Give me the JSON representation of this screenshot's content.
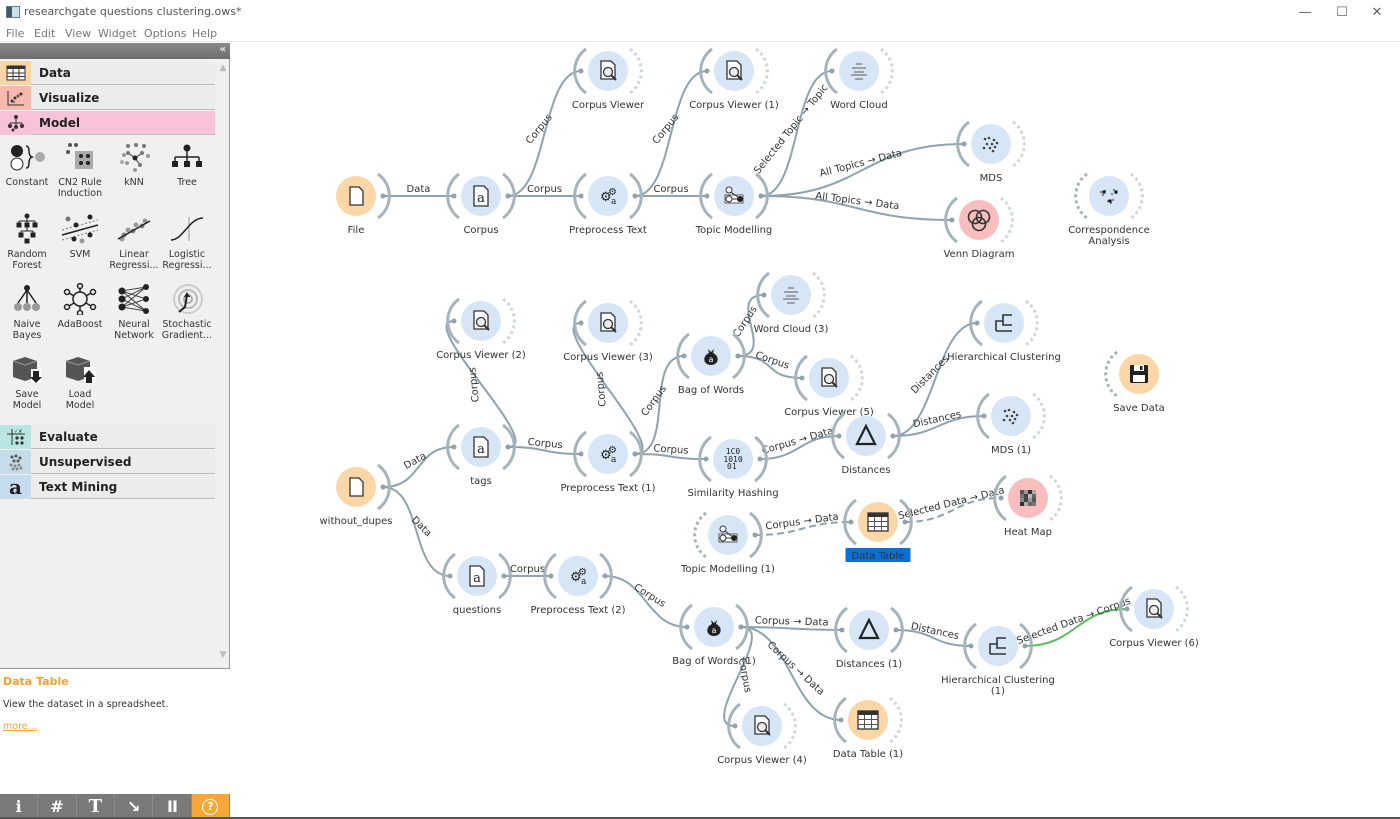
{
  "window": {
    "title": "researchgate questions clustering.ows*",
    "controls": {
      "minimize": "—",
      "maximize": "☐",
      "close": "✕"
    }
  },
  "menu": [
    "File",
    "Edit",
    "View",
    "Widget",
    "Options",
    "Help"
  ],
  "dock": {
    "collapse_icon": "«",
    "categories": [
      {
        "label": "Data",
        "icon": "data-table-icon",
        "color": "#f9d6a3"
      },
      {
        "label": "Visualize",
        "icon": "scatter-icon",
        "color": "#f7b9ad"
      },
      {
        "label": "Model",
        "icon": "hierarchy-icon",
        "color": "#f8c2d9",
        "expanded": true
      },
      {
        "label": "Evaluate",
        "icon": "evaluate-icon",
        "color": "#b9e5e2"
      },
      {
        "label": "Unsupervised",
        "icon": "clusters-icon",
        "color": "#c6dce8"
      },
      {
        "label": "Text Mining",
        "icon": "letter-a-icon",
        "color": "#c8dcef"
      }
    ],
    "model_tools": [
      {
        "label": "Constant",
        "icon": "constant-icon"
      },
      {
        "label": "CN2 Rule Induction",
        "icon": "cn2-icon"
      },
      {
        "label": "kNN",
        "icon": "knn-icon"
      },
      {
        "label": "Tree",
        "icon": "tree-icon"
      },
      {
        "label": "Random Forest",
        "icon": "random-forest-icon"
      },
      {
        "label": "SVM",
        "icon": "svm-icon"
      },
      {
        "label": "Linear Regressi...",
        "icon": "linear-regression-icon"
      },
      {
        "label": "Logistic Regressi...",
        "icon": "logistic-regression-icon"
      },
      {
        "label": "Naive Bayes",
        "icon": "naive-bayes-icon"
      },
      {
        "label": "AdaBoost",
        "icon": "adaboost-icon"
      },
      {
        "label": "Neural Network",
        "icon": "neural-network-icon"
      },
      {
        "label": "Stochastic Gradient...",
        "icon": "sgd-icon"
      },
      {
        "label": "Save Model",
        "icon": "save-model-icon"
      },
      {
        "label": "Load Model",
        "icon": "load-model-icon"
      }
    ],
    "help": {
      "title": "Data Table",
      "description": "View the dataset in a spreadsheet.",
      "more_link": "more..."
    },
    "toolbar": [
      {
        "label": "i",
        "icon": "info-icon"
      },
      {
        "label": "#",
        "icon": "grid-icon"
      },
      {
        "label": "T",
        "icon": "text-annotation-icon"
      },
      {
        "label": "↘",
        "icon": "arrow-annotation-icon"
      },
      {
        "label": "II",
        "icon": "pause-icon"
      },
      {
        "label": "?",
        "icon": "help-icon"
      }
    ]
  },
  "colors": {
    "blue_node": "#d6e6f7",
    "orange_node": "#fbd7a8",
    "red_node": "#f8bdbd",
    "link": "#8fa3ad",
    "link_selected": "#5cbb5c",
    "selection": "#0a6fd6"
  },
  "workflow": {
    "nodes": [
      {
        "id": "file",
        "label": "File",
        "kind": "orange",
        "icon": "file-icon"
      },
      {
        "id": "corpus",
        "label": "Corpus",
        "kind": "blue",
        "icon": "corpus-icon"
      },
      {
        "id": "cv0",
        "label": "Corpus Viewer",
        "kind": "blue",
        "icon": "corpus-viewer-icon"
      },
      {
        "id": "pp0",
        "label": "Preprocess Text",
        "kind": "blue",
        "icon": "preprocess-icon"
      },
      {
        "id": "cv1",
        "label": "Corpus Viewer (1)",
        "kind": "blue",
        "icon": "corpus-viewer-icon"
      },
      {
        "id": "tm0",
        "label": "Topic Modelling",
        "kind": "blue",
        "icon": "topic-modelling-icon"
      },
      {
        "id": "wc0",
        "label": "Word Cloud",
        "kind": "blue",
        "icon": "word-cloud-icon"
      },
      {
        "id": "mds0",
        "label": "MDS",
        "kind": "blue",
        "icon": "mds-icon"
      },
      {
        "id": "venn",
        "label": "Venn Diagram",
        "kind": "red",
        "icon": "venn-icon"
      },
      {
        "id": "ca",
        "label": "Correspondence Analysis",
        "kind": "blue",
        "icon": "correspondence-icon"
      },
      {
        "id": "wd",
        "label": "without_dupes",
        "kind": "orange",
        "icon": "file-icon"
      },
      {
        "id": "tags",
        "label": "tags",
        "kind": "blue",
        "icon": "corpus-icon"
      },
      {
        "id": "cv2",
        "label": "Corpus Viewer (2)",
        "kind": "blue",
        "icon": "corpus-viewer-icon"
      },
      {
        "id": "pp1",
        "label": "Preprocess Text (1)",
        "kind": "blue",
        "icon": "preprocess-icon"
      },
      {
        "id": "cv3",
        "label": "Corpus Viewer (3)",
        "kind": "blue",
        "icon": "corpus-viewer-icon"
      },
      {
        "id": "bow0",
        "label": "Bag of Words",
        "kind": "blue",
        "icon": "bag-of-words-icon"
      },
      {
        "id": "wc3",
        "label": "Word Cloud (3)",
        "kind": "blue",
        "icon": "word-cloud-icon"
      },
      {
        "id": "cv5",
        "label": "Corpus Viewer (5)",
        "kind": "blue",
        "icon": "corpus-viewer-icon"
      },
      {
        "id": "sh",
        "label": "Similarity Hashing",
        "kind": "blue",
        "icon": "similarity-hashing-icon"
      },
      {
        "id": "dist0",
        "label": "Distances",
        "kind": "blue",
        "icon": "distances-icon"
      },
      {
        "id": "hc0",
        "label": "Hierarchical Clustering",
        "kind": "blue",
        "icon": "hierarchical-clustering-icon"
      },
      {
        "id": "mds1",
        "label": "MDS (1)",
        "kind": "blue",
        "icon": "mds-icon"
      },
      {
        "id": "savedata",
        "label": "Save Data",
        "kind": "orange",
        "icon": "save-icon"
      },
      {
        "id": "tm1",
        "label": "Topic Modelling (1)",
        "kind": "blue",
        "icon": "topic-modelling-icon"
      },
      {
        "id": "dt0",
        "label": "Data Table",
        "kind": "orange",
        "icon": "data-table-icon",
        "selected": true
      },
      {
        "id": "heat",
        "label": "Heat Map",
        "kind": "red",
        "icon": "heat-map-icon"
      },
      {
        "id": "questions",
        "label": "questions",
        "kind": "blue",
        "icon": "corpus-icon"
      },
      {
        "id": "pp2",
        "label": "Preprocess Text (2)",
        "kind": "blue",
        "icon": "preprocess-icon"
      },
      {
        "id": "bow1",
        "label": "Bag of Words (1)",
        "kind": "blue",
        "icon": "bag-of-words-icon"
      },
      {
        "id": "cv4",
        "label": "Corpus Viewer (4)",
        "kind": "blue",
        "icon": "corpus-viewer-icon"
      },
      {
        "id": "dist1",
        "label": "Distances (1)",
        "kind": "blue",
        "icon": "distances-icon"
      },
      {
        "id": "dt1",
        "label": "Data Table (1)",
        "kind": "orange",
        "icon": "data-table-icon"
      },
      {
        "id": "hc1",
        "label": "Hierarchical Clustering (1)",
        "kind": "blue",
        "icon": "hierarchical-clustering-icon"
      },
      {
        "id": "cv6",
        "label": "Corpus Viewer (6)",
        "kind": "blue",
        "icon": "corpus-viewer-icon"
      }
    ],
    "links": [
      {
        "from": "file",
        "to": "corpus",
        "label": "Data"
      },
      {
        "from": "corpus",
        "to": "cv0",
        "label": "Corpus"
      },
      {
        "from": "corpus",
        "to": "pp0",
        "label": "Corpus"
      },
      {
        "from": "pp0",
        "to": "cv1",
        "label": "Corpus"
      },
      {
        "from": "pp0",
        "to": "tm0",
        "label": "Corpus"
      },
      {
        "from": "tm0",
        "to": "wc0",
        "label": "Selected Topic → Topic"
      },
      {
        "from": "tm0",
        "to": "mds0",
        "label": "All Topics → Data"
      },
      {
        "from": "tm0",
        "to": "venn",
        "label": "All Topics → Data"
      },
      {
        "from": "wd",
        "to": "tags",
        "label": "Data"
      },
      {
        "from": "wd",
        "to": "questions",
        "label": "Data"
      },
      {
        "from": "tags",
        "to": "cv2",
        "label": "Corpus"
      },
      {
        "from": "tags",
        "to": "pp1",
        "label": "Corpus"
      },
      {
        "from": "pp1",
        "to": "cv3",
        "label": "Corpus"
      },
      {
        "from": "pp1",
        "to": "bow0",
        "label": "Corpus"
      },
      {
        "from": "pp1",
        "to": "sh",
        "label": "Corpus"
      },
      {
        "from": "bow0",
        "to": "wc3",
        "label": "Corpus"
      },
      {
        "from": "bow0",
        "to": "cv5",
        "label": "Corpus"
      },
      {
        "from": "sh",
        "to": "dist0",
        "label": "Corpus → Data"
      },
      {
        "from": "dist0",
        "to": "hc0",
        "label": "Distances"
      },
      {
        "from": "dist0",
        "to": "mds1",
        "label": "Distances"
      },
      {
        "from": "tm1",
        "to": "dt0",
        "label": "Corpus → Data",
        "dashed": true
      },
      {
        "from": "dt0",
        "to": "heat",
        "label": "Selected Data → Data",
        "dashed": true
      },
      {
        "from": "questions",
        "to": "pp2",
        "label": "Corpus"
      },
      {
        "from": "pp2",
        "to": "bow1",
        "label": "Corpus"
      },
      {
        "from": "bow1",
        "to": "dist1",
        "label": "Corpus → Data"
      },
      {
        "from": "bow1",
        "to": "dt1",
        "label": "Corpus → Data"
      },
      {
        "from": "bow1",
        "to": "cv4",
        "label": "Corpus"
      },
      {
        "from": "dist1",
        "to": "hc1",
        "label": "Distances"
      },
      {
        "from": "hc1",
        "to": "cv6",
        "label": "Selected Data → Corpus",
        "highlighted": true
      }
    ]
  }
}
